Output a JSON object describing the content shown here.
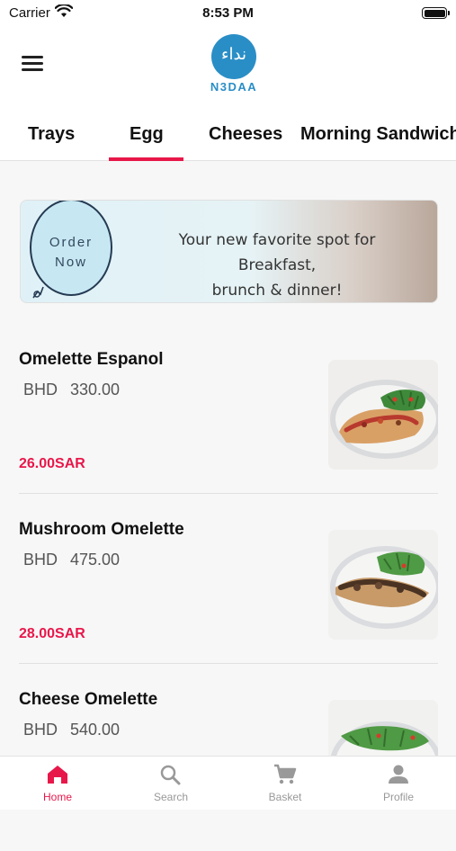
{
  "status_bar": {
    "carrier": "Carrier",
    "time": "8:53 PM",
    "battery_level": 1.0
  },
  "header": {
    "menu_icon": "hamburger-menu-icon",
    "logo_text": "N3DAA",
    "logo_script": "نداء",
    "brand_color": "#2a8ec6"
  },
  "tabs": [
    {
      "label": "Trays",
      "active": false
    },
    {
      "label": "Egg",
      "active": true
    },
    {
      "label": "Cheeses",
      "active": false
    },
    {
      "label": "Morning Sandwich",
      "active": false
    }
  ],
  "banner": {
    "button_text_1": "Order",
    "button_text_2": "Now",
    "tagline_1": "Your new favorite spot for Breakfast,",
    "tagline_2": "brunch & dinner!"
  },
  "products": [
    {
      "name": "Omelette Espanol",
      "currency": "BHD",
      "original_price": "330.00",
      "price": "26.00SAR"
    },
    {
      "name": "Mushroom Omelette",
      "currency": "BHD",
      "original_price": "475.00",
      "price": "28.00SAR"
    },
    {
      "name": "Cheese Omelette",
      "currency": "BHD",
      "original_price": "540.00",
      "price": ""
    }
  ],
  "bottom_nav": [
    {
      "label": "Home",
      "icon": "home-icon",
      "active": true
    },
    {
      "label": "Search",
      "icon": "search-icon",
      "active": false
    },
    {
      "label": "Basket",
      "icon": "cart-icon",
      "active": false
    },
    {
      "label": "Profile",
      "icon": "person-icon",
      "active": false
    }
  ],
  "colors": {
    "accent": "#e8174a",
    "muted": "#999999"
  }
}
